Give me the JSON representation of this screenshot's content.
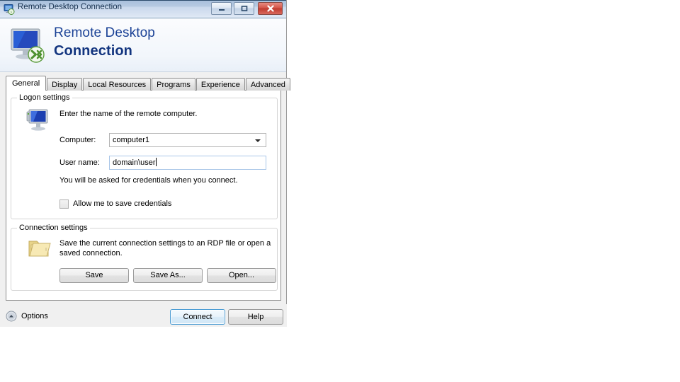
{
  "window": {
    "title": "Remote Desktop Connection",
    "titlebar_icon": "remote-desktop-icon",
    "controls": {
      "minimize": "minimize-icon",
      "maximize": "maximize-icon",
      "close": "close-icon"
    }
  },
  "banner": {
    "icon": "remote-desktop-monitor-icon",
    "line1": "Remote Desktop",
    "line2": "Connection",
    "title_color": "#1b4296"
  },
  "tabs": [
    {
      "label": "General",
      "active": true
    },
    {
      "label": "Display",
      "active": false
    },
    {
      "label": "Local Resources",
      "active": false
    },
    {
      "label": "Programs",
      "active": false
    },
    {
      "label": "Experience",
      "active": false
    },
    {
      "label": "Advanced",
      "active": false
    }
  ],
  "logon_settings": {
    "group_title": "Logon settings",
    "icon": "computer-monitor-icon",
    "description": "Enter the name of the remote computer.",
    "computer_label": "Computer:",
    "computer_value": "computer1",
    "computer_dropdown_icon": "chevron-down-icon",
    "username_label": "User name:",
    "username_value": "domain\\user",
    "username_focused": true,
    "credentials_note": "You will be asked for credentials when you connect.",
    "save_credentials_label": "Allow me to save credentials",
    "save_credentials_checked": false
  },
  "connection_settings": {
    "group_title": "Connection settings",
    "icon": "open-folder-icon",
    "description": "Save the current connection settings to an RDP file or open a saved connection.",
    "buttons": {
      "save": "Save",
      "save_as": "Save As...",
      "open": "Open..."
    }
  },
  "footer": {
    "options_icon": "chevron-up-circle-icon",
    "options_label": "Options",
    "connect_label": "Connect",
    "help_label": "Help",
    "default_button": "Connect",
    "accent_color": "#4b9cd3"
  }
}
